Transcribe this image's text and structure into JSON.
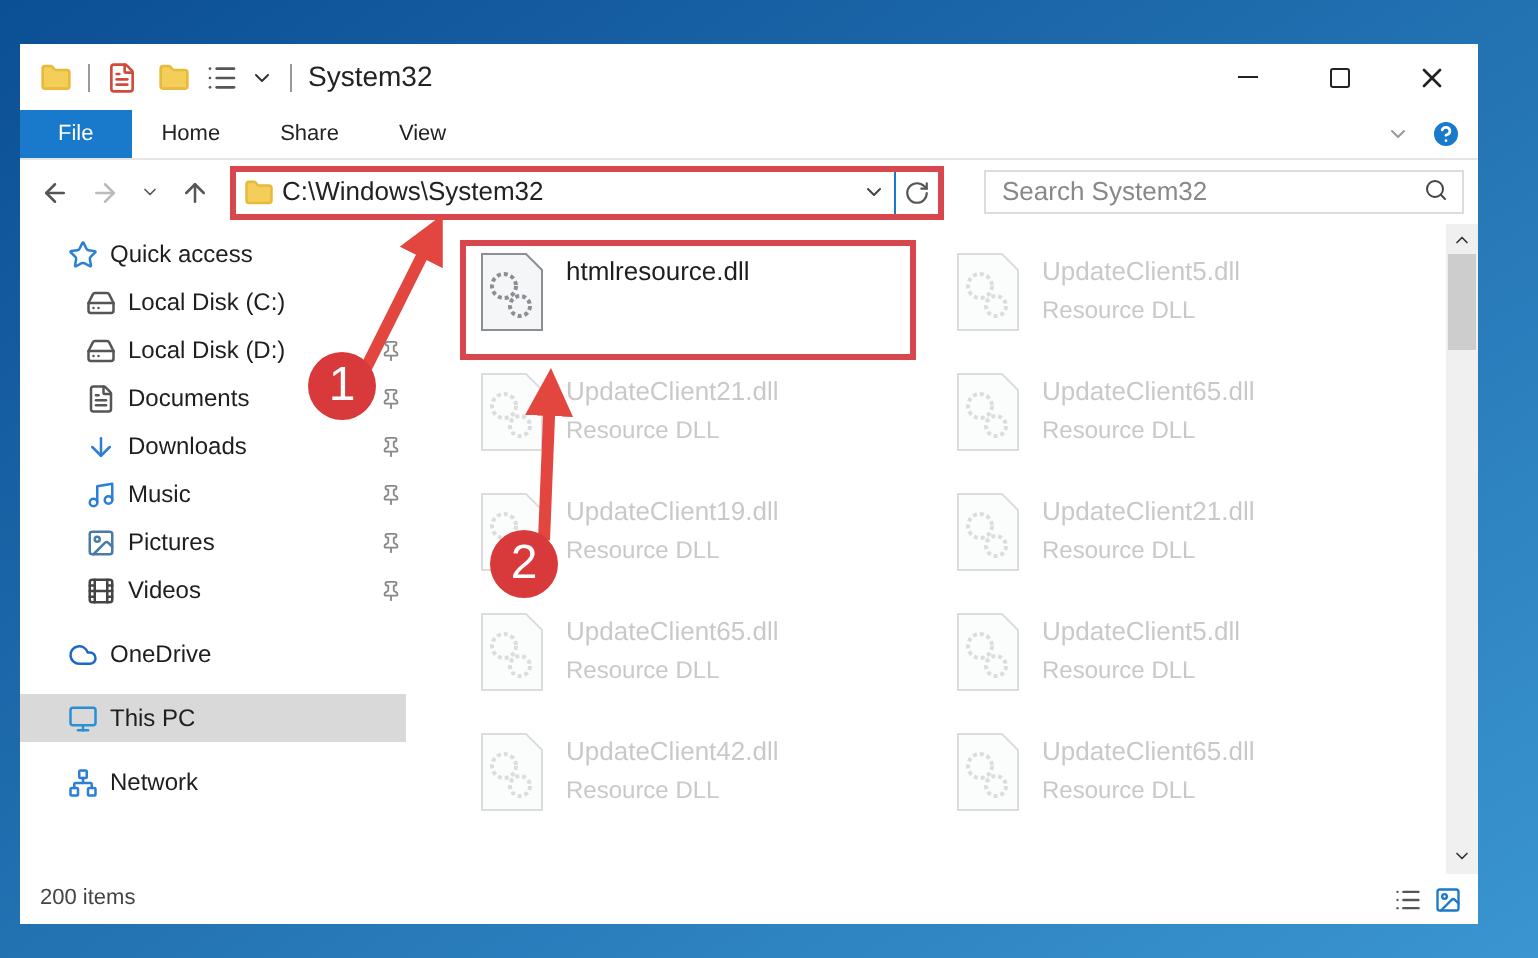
{
  "window": {
    "title": "System32"
  },
  "ribbon": {
    "tabs": [
      {
        "label": "File",
        "selected": true
      },
      {
        "label": "Home",
        "selected": false
      },
      {
        "label": "Share",
        "selected": false
      },
      {
        "label": "View",
        "selected": false
      }
    ]
  },
  "address_bar": {
    "path": "C:\\Windows\\System32",
    "highlighted": true
  },
  "search": {
    "placeholder": "Search System32"
  },
  "sidebar": {
    "items": [
      {
        "label": "Quick access",
        "kind": "star",
        "pinned": false,
        "selected": false,
        "group_start": false
      },
      {
        "label": "Local Disk (C:)",
        "kind": "disk",
        "pinned": false,
        "selected": false,
        "group_start": false
      },
      {
        "label": "Local Disk (D:)",
        "kind": "disk",
        "pinned": true,
        "selected": false,
        "group_start": false
      },
      {
        "label": "Documents",
        "kind": "document",
        "pinned": true,
        "selected": false,
        "group_start": false
      },
      {
        "label": "Downloads",
        "kind": "download",
        "pinned": true,
        "selected": false,
        "group_start": false
      },
      {
        "label": "Music",
        "kind": "music",
        "pinned": true,
        "selected": false,
        "group_start": false
      },
      {
        "label": "Pictures",
        "kind": "picture",
        "pinned": true,
        "selected": false,
        "group_start": false
      },
      {
        "label": "Videos",
        "kind": "video",
        "pinned": true,
        "selected": false,
        "group_start": false
      },
      {
        "label": "OneDrive",
        "kind": "cloud",
        "pinned": false,
        "selected": false,
        "group_start": true
      },
      {
        "label": "This PC",
        "kind": "computer",
        "pinned": false,
        "selected": true,
        "group_start": true
      },
      {
        "label": "Network",
        "kind": "network",
        "pinned": false,
        "selected": false,
        "group_start": true
      }
    ]
  },
  "files": [
    {
      "name": "htmlresource.dll",
      "highlighted": true,
      "faded": false
    },
    {
      "name": "UpdateClient5.dll",
      "type": "Resource DLL",
      "highlighted": false,
      "faded": true
    },
    {
      "name": "UpdateClient21.dll",
      "type": "Resource DLL",
      "highlighted": false,
      "faded": true
    },
    {
      "name": "UpdateClient65.dll",
      "type": "Resource DLL",
      "highlighted": false,
      "faded": true
    },
    {
      "name": "UpdateClient19.dll",
      "type": "Resource DLL",
      "highlighted": false,
      "faded": true
    },
    {
      "name": "UpdateClient21.dll",
      "type": "Resource DLL",
      "highlighted": false,
      "faded": true
    },
    {
      "name": "UpdateClient65.dll",
      "type": "Resource DLL",
      "highlighted": false,
      "faded": true
    },
    {
      "name": "UpdateClient5.dll",
      "type": "Resource DLL",
      "highlighted": false,
      "faded": true
    },
    {
      "name": "UpdateClient42.dll",
      "type": "Resource DLL",
      "highlighted": false,
      "faded": true
    },
    {
      "name": "UpdateClient65.dll",
      "type": "Resource DLL",
      "highlighted": false,
      "faded": true
    }
  ],
  "status_bar": {
    "count": "200 items"
  },
  "annotations": [
    {
      "label": "1"
    },
    {
      "label": "2"
    }
  ]
}
